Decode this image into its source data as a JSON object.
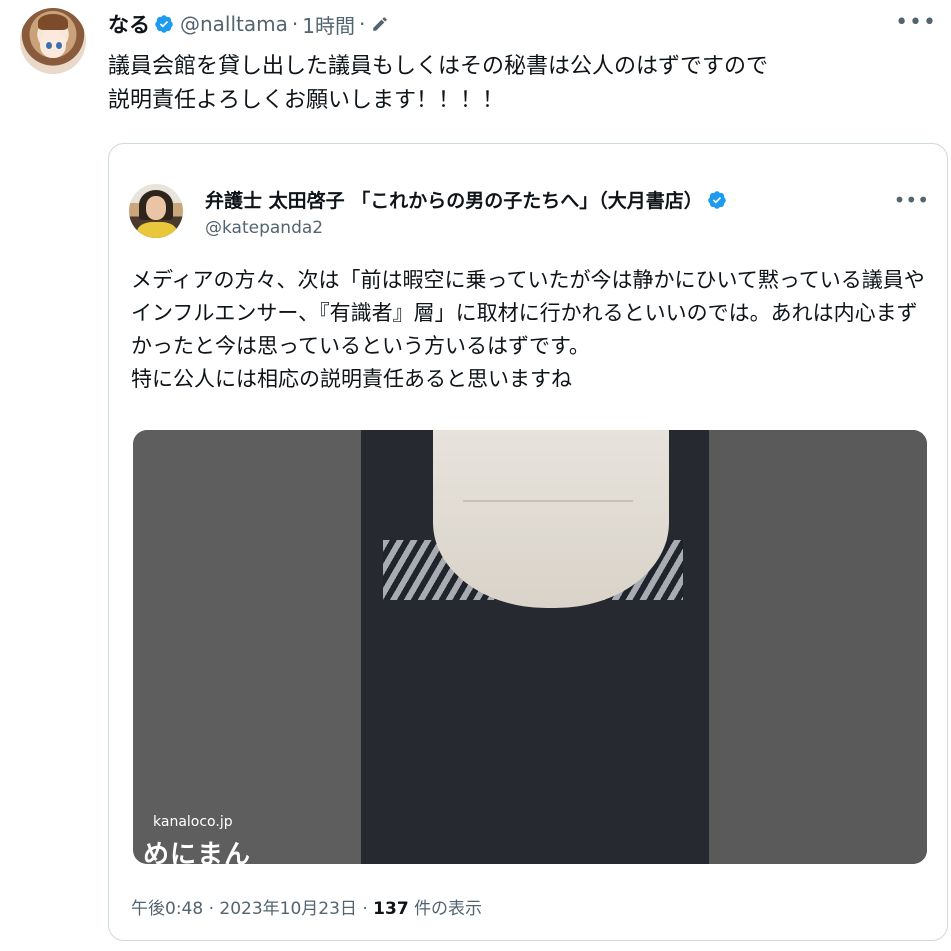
{
  "main_tweet": {
    "display_name": "なる",
    "handle": "@nalltama",
    "separator": "·",
    "time": "1時間",
    "text": "議員会館を貸し出した議員もしくはその秘書は公人のはずですので\n説明責任よろしくお願いします！！！！",
    "more": "•••"
  },
  "quoted_tweet": {
    "display_name": "弁護士 太田啓子 「これからの男の子たちへ」（大月書店）",
    "handle": "@katepanda2",
    "more": "•••",
    "text": "メディアの方々、次は「前は暇空に乗っていたが今は静かにひいて黙っている議員やインフルエンサー、『有識者』層」に取材に行かれるといいのでは。あれは内心まずかったと今は思っているという方いるはずです。\n特に公人には相応の説明責任あると思いますね",
    "video": {
      "watermark_text": "kanaloco.jp",
      "watermark_logo": "めにまん"
    },
    "footer": {
      "time": "午後0:48",
      "date": "2023年10月23日",
      "separator": "·",
      "views_count": "137",
      "views_label": "件の表示"
    }
  },
  "colors": {
    "verified_blue": "#1d9bf0",
    "secondary_text": "#536471",
    "border": "#cfd9de"
  }
}
